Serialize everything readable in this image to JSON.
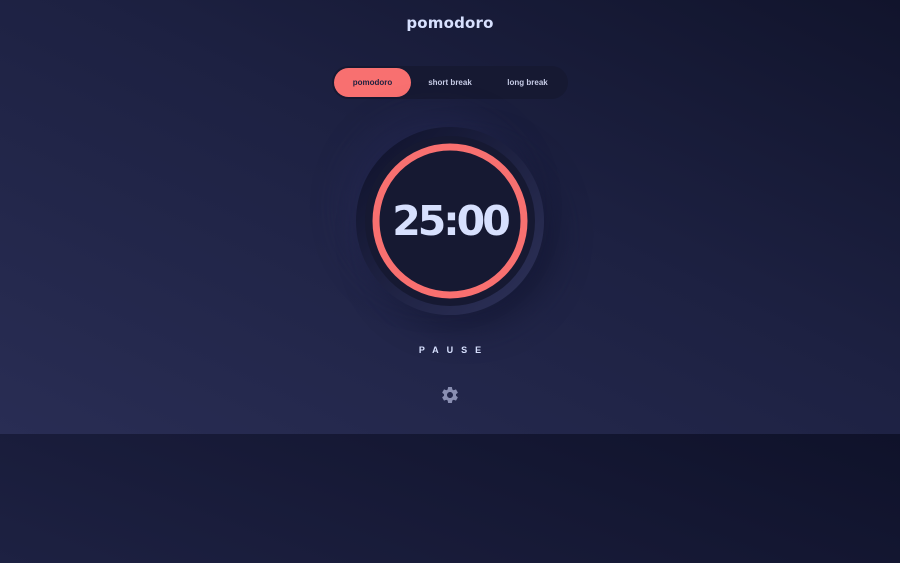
{
  "app": {
    "title": "pomodoro"
  },
  "modes": {
    "items": [
      {
        "label": "pomodoro",
        "active": true
      },
      {
        "label": "short break",
        "active": false
      },
      {
        "label": "long break",
        "active": false
      }
    ]
  },
  "timer": {
    "time": "25:00",
    "progress": 1.0,
    "accent_color": "#f87070"
  },
  "controls": {
    "pause_label": "PAUSE",
    "settings_icon": "gear-icon"
  },
  "colors": {
    "accent": "#f87070",
    "text": "#d7e0fe",
    "surface": "#161932"
  }
}
